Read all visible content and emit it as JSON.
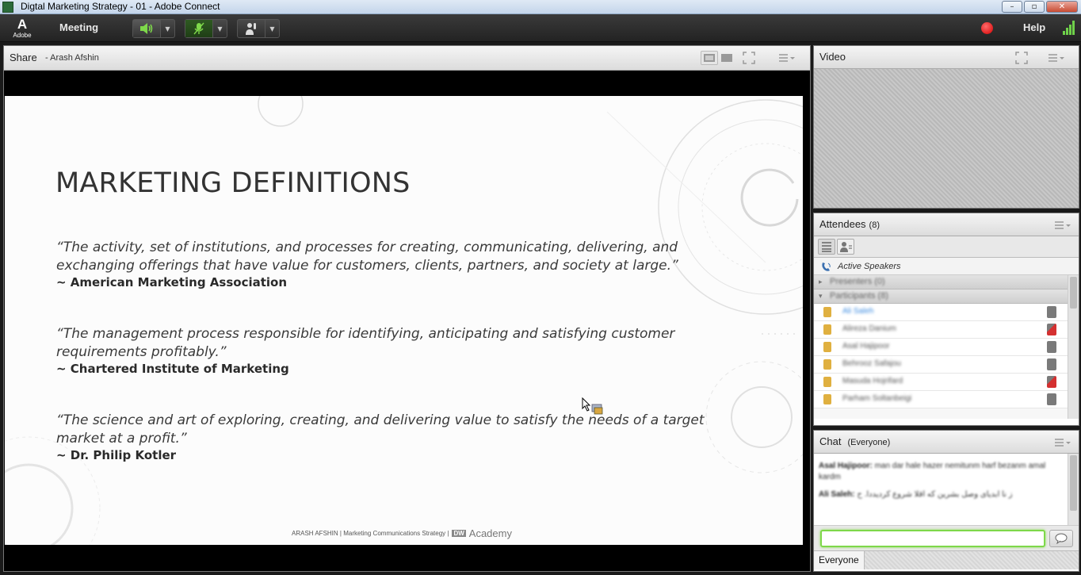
{
  "window": {
    "title": "Digtal Marketing Strategy - 01 - Adobe Connect",
    "controls": {
      "minimize": "–",
      "maximize": "▫",
      "close": "✕"
    }
  },
  "menubar": {
    "logo_mark": "A",
    "logo_text": "Adobe",
    "meeting_label": "Meeting",
    "help_label": "Help",
    "icons": [
      "speaker-icon",
      "microphone-icon",
      "raise-hand-icon",
      "chevron-down-icon",
      "record-icon",
      "signal-icon"
    ]
  },
  "share_pod": {
    "title": "Share",
    "presenter": "- Arash Afshin",
    "slide": {
      "heading": "MARKETING DEFINITIONS",
      "quotes": [
        {
          "text": "“The activity, set of institutions, and processes for creating, communicating, delivering, and exchanging offerings that have value for customers, clients, partners, and society at large.”",
          "source": "~ American Marketing Association"
        },
        {
          "text": "“The management process responsible for identifying, anticipating and satisfying customer requirements profitably.”",
          "source": "~ Chartered Institute of Marketing"
        },
        {
          "text": "“The science and art of exploring, creating, and delivering value to satisfy the needs of a target market at a profit.”",
          "source": "~ Dr. Philip Kotler"
        }
      ],
      "footer_text": "ARASH AFSHIN | Marketing Communications Strategy |",
      "footer_brand": "Academy",
      "footer_brand_prefix": "DW"
    }
  },
  "video_pod": {
    "title": "Video"
  },
  "attendees_pod": {
    "title": "Attendees",
    "count": "(8)",
    "active_speakers": "Active Speakers",
    "groups": [
      {
        "label": "Presenters (0)"
      },
      {
        "label": "Participants (8)"
      }
    ],
    "participants": [
      {
        "name": "Ali Saleh",
        "presenter": true,
        "mic": false
      },
      {
        "name": "Alireza Danium",
        "presenter": false,
        "mic": true
      },
      {
        "name": "Asal Hajipoor",
        "presenter": false,
        "mic": false
      },
      {
        "name": "Behrooz Safajou",
        "presenter": false,
        "mic": false
      },
      {
        "name": "Masuda Hojrifard",
        "presenter": false,
        "mic": true
      },
      {
        "name": "Parham Soltanbeigi",
        "presenter": false,
        "mic": false
      }
    ]
  },
  "chat_pod": {
    "title": "Chat",
    "scope": "(Everyone)",
    "messages": [
      {
        "author": "Asal Hajipoor:",
        "text": "man dar hale hazer nemitunm harf bezanm amal kardm"
      },
      {
        "author": "Ali Saleh:",
        "text": "ز نا ابدیای وصل بشرین که اقلا شروع کردیددا. ح"
      }
    ],
    "input_value": "",
    "footer_scope": "Everyone"
  },
  "colors": {
    "accent_green": "#7ed84a",
    "record_red": "#d40000",
    "presenter_blue": "#3a8ae0"
  }
}
